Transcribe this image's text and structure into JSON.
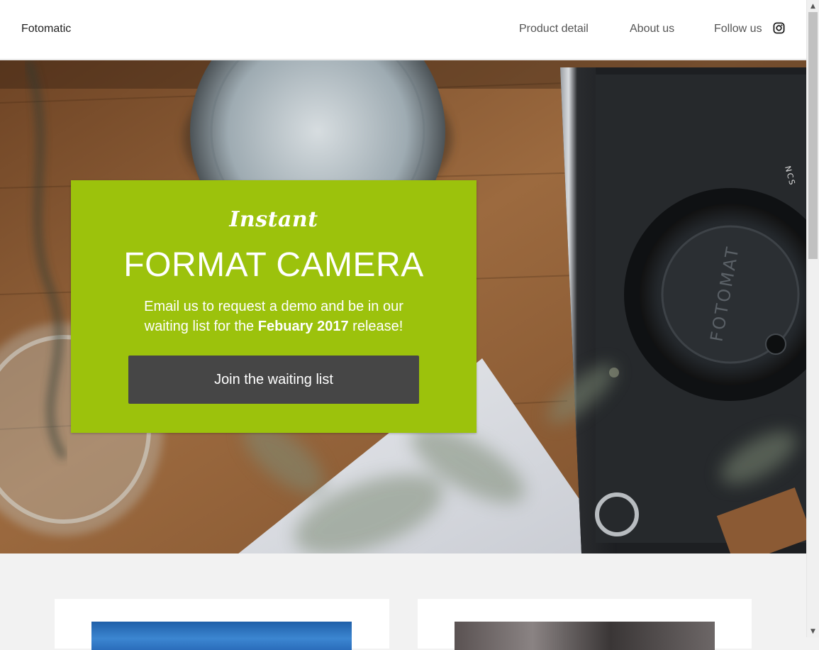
{
  "nav": {
    "brand": "Fotomatic",
    "links": [
      "Product detail",
      "About us",
      "Follow us"
    ]
  },
  "hero": {
    "eyebrow": "Instant",
    "title": "FORMAT CAMERA",
    "text_before": "Email us to request a demo and be in our waiting list for the ",
    "text_bold": "Febuary 2017",
    "text_after": " release!",
    "cta_label": "Join the waiting list",
    "camera_brand": "FOTOMAT",
    "camera_mark": "NCS"
  },
  "colors": {
    "accent": "#9cc20c",
    "button": "#464646",
    "nav_bg": "#ffffff",
    "page_bg": "#f2f2f2"
  },
  "icons": {
    "social": "instagram-icon"
  }
}
